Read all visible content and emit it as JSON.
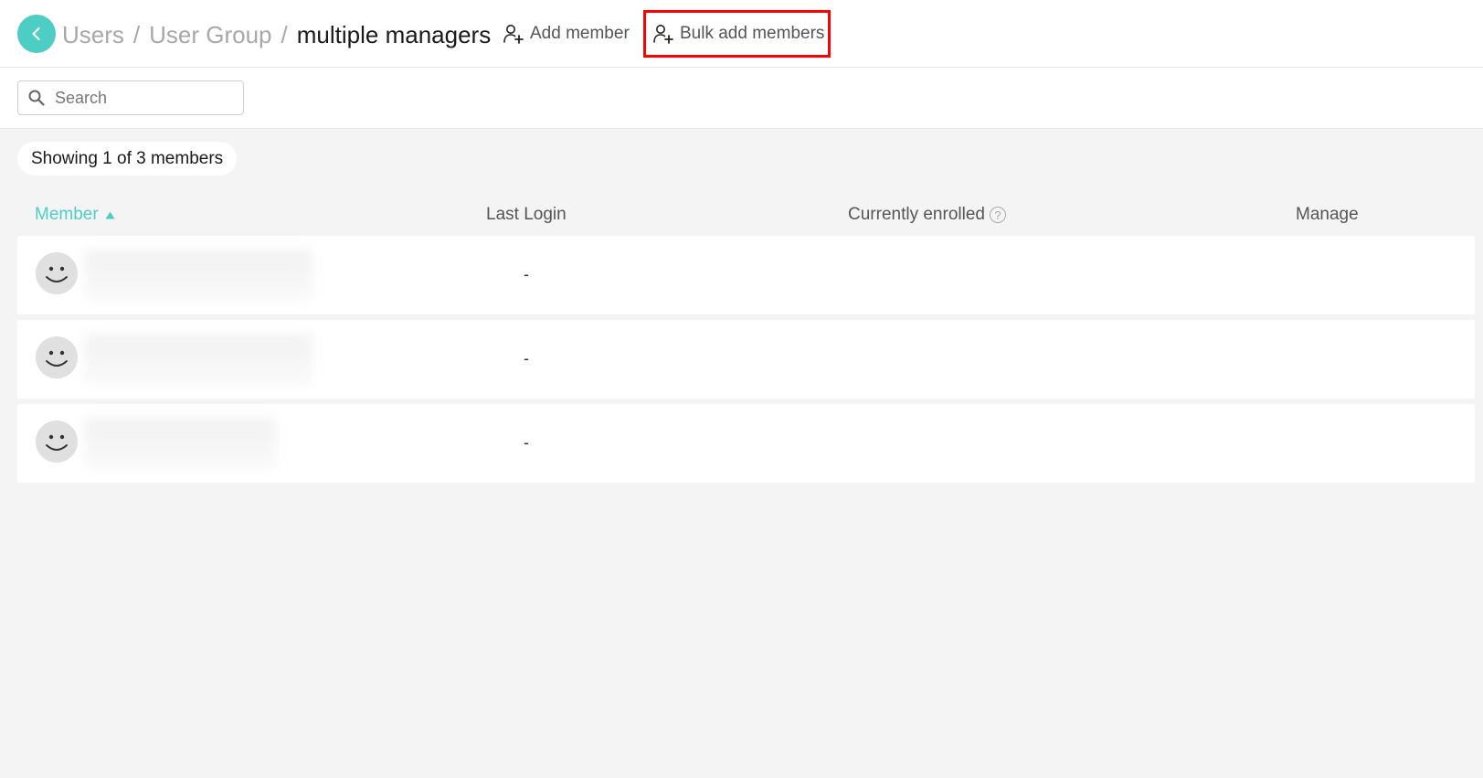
{
  "breadcrumb": {
    "items": [
      "Users",
      "User Group"
    ],
    "separator": "/",
    "current": "multiple managers"
  },
  "toolbar": {
    "add_member_label": "Add member",
    "bulk_add_label": "Bulk add members"
  },
  "search": {
    "placeholder": "Search",
    "value": ""
  },
  "summary": {
    "count_text": "Showing 1 of 3 members"
  },
  "table": {
    "columns": {
      "member": "Member",
      "last_login": "Last Login",
      "currently_enrolled": "Currently enrolled",
      "manage": "Manage"
    },
    "help_glyph": "?",
    "sort": "member-ascending",
    "rows": [
      {
        "last_login": "-"
      },
      {
        "last_login": "-"
      },
      {
        "last_login": "-"
      }
    ]
  },
  "colors": {
    "accent": "#4ecdc4",
    "highlight_border": "#ff0000"
  },
  "icons": {
    "back": "chevron-left-icon",
    "add_user": "add-user-icon",
    "search": "search-icon",
    "sort": "triangle-up-icon",
    "help": "question-circle-icon",
    "avatar": "smiley-face-icon"
  }
}
